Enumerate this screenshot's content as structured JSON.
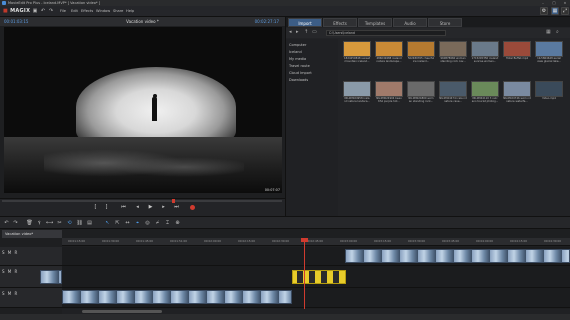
{
  "window": {
    "title": "MovieEdit Pro Plus - Iceland.MVP* [ Vacation video* ]"
  },
  "menubar": {
    "logo": "MAGIX",
    "items": [
      "File",
      "Edit",
      "Effects",
      "Window",
      "Share",
      "Help"
    ]
  },
  "monitor": {
    "timecode_left": "00:01:03:15",
    "title": "Vacation video *",
    "timecode_right": "00:02:27:17",
    "overlay_timecode": "00:07:07"
  },
  "media_pool": {
    "tabs": [
      "Import",
      "Effects",
      "Templates",
      "Audio",
      "Store"
    ],
    "active_tab": "Import",
    "path": "C:\\Users\\Iceland",
    "tree": [
      "Computer",
      "Iceland",
      "My media",
      "Travel route",
      "Cloud Import",
      "Downloads"
    ],
    "thumbs": [
      {
        "caption": "1824250848 sunset mountain iceland...",
        "color": "#d89a3c"
      },
      {
        "caption": "486049488 iceland nature landscape...",
        "color": "#c98a36"
      },
      {
        "caption": "502480765 cheerful ice iceland...",
        "color": "#b57a30"
      },
      {
        "caption": "960878660 woman standing rock cav...",
        "color": "#7a6a5a"
      },
      {
        "caption": "1715245350 iceland sunrise woman...",
        "color": "#6a7a8a"
      },
      {
        "caption": "Hotel Buffet.mp4",
        "color": "#9a4a3a"
      },
      {
        "caption": "1K-5864648 aerial view glacial lake...",
        "color": "#5a7aa0"
      },
      {
        "caption": "NK-0M024958 icela nd nature landsca...",
        "color": "#8a9aa8"
      },
      {
        "caption": "NK-0M024904 beau tiful purple hot...",
        "color": "#a07a6a"
      },
      {
        "caption": "NK-0M024800 wom an standing rock...",
        "color": "#6a6a6a"
      },
      {
        "caption": "NK-0M24474 icela nd nature cave...",
        "color": "#4a5a6a"
      },
      {
        "caption": "NK-0M44110 3 vulc ano tourist photog...",
        "color": "#6a8a5a"
      },
      {
        "caption": "NK-0M24746 wom nd nature waterfa...",
        "color": "#7a8aa0"
      },
      {
        "caption": "Video.mp4",
        "color": "#3a4a5a"
      }
    ]
  },
  "timeline": {
    "tab_label": "Vacation video*",
    "ruler_ticks": [
      "00:01:15:00",
      "00:01:30:00",
      "00:01:45:00",
      "00:01:51:00",
      "00:02:00:00",
      "00:02:15:00",
      "00:02:30:00",
      "00:02:45:00",
      "00:03:00:00",
      "00:03:15:00",
      "00:03:30:00",
      "00:03:45:00",
      "00:04:00:00",
      "00:04:15:00",
      "00:04:30:00"
    ],
    "track_label": "S M R"
  },
  "colors": {
    "accent": "#3c5d86",
    "playhead": "#d03b2f",
    "clip_yellow": "#e8cc2a"
  }
}
